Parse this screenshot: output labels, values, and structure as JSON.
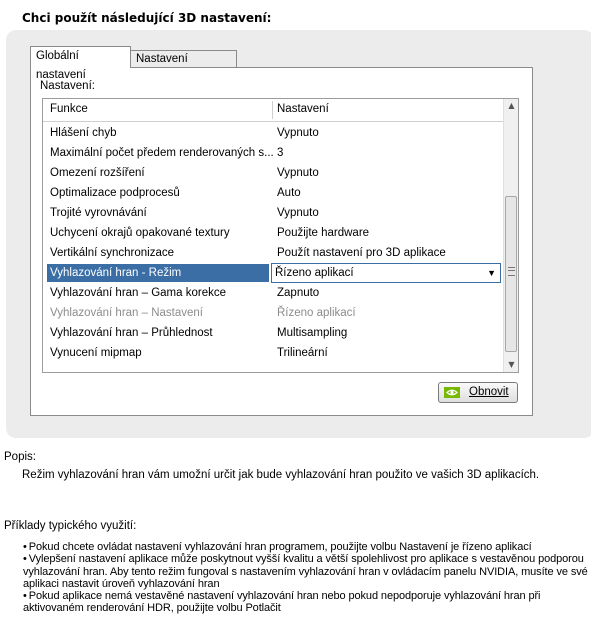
{
  "heading": "Chci použít následující 3D nastavení:",
  "tabs": [
    {
      "label": "Globální nastavení",
      "active": true
    },
    {
      "label": "Nastavení programu",
      "active": false
    }
  ],
  "settings_label": "Nastavení:",
  "columns": {
    "feature": "Funkce",
    "setting": "Nastavení"
  },
  "rows": [
    {
      "feature": "Hlášení chyb",
      "setting": "Vypnuto",
      "state": "normal"
    },
    {
      "feature": "Maximální počet předem renderovaných s...",
      "setting": "3",
      "state": "normal"
    },
    {
      "feature": "Omezení rozšíření",
      "setting": "Vypnuto",
      "state": "normal"
    },
    {
      "feature": "Optimalizace podprocesů",
      "setting": "Auto",
      "state": "normal"
    },
    {
      "feature": "Trojité vyrovnávání",
      "setting": "Vypnuto",
      "state": "normal"
    },
    {
      "feature": "Uchycení okrajů opakované textury",
      "setting": "Použijte hardware",
      "state": "normal"
    },
    {
      "feature": "Vertikální synchronizace",
      "setting": "Použít nastavení pro 3D aplikace",
      "state": "normal"
    },
    {
      "feature": "Vyhlazování hran - Režim",
      "setting": "Řízeno aplikací",
      "state": "selected"
    },
    {
      "feature": "Vyhlazování hran – Gama korekce",
      "setting": "Zapnuto",
      "state": "normal"
    },
    {
      "feature": "Vyhlazování hran – Nastavení",
      "setting": "Řízeno aplikací",
      "state": "disabled"
    },
    {
      "feature": "Vyhlazování hran – Průhlednost",
      "setting": "Multisampling",
      "state": "normal"
    },
    {
      "feature": "Vynucení mipmap",
      "setting": "Trilineární",
      "state": "normal"
    }
  ],
  "restore_button": "Obnovit",
  "description": {
    "title": "Popis:",
    "text": "Režim vyhlazování hran vám umožní určit jak bude vyhlazování hran použito ve vašich 3D aplikacích."
  },
  "examples": {
    "title": "Příklady typického využití:",
    "items": [
      "Pokud chcete ovládat nastavení vyhlazování hran programem, použijte volbu Nastavení je řízeno aplikací",
      "Vylepšení nastavení aplikace může poskytnout vyšší kvalitu a větší spolehlivost pro aplikace s vestavěnou podporou vyhlazování hran. Aby tento režim fungoval s nastavením vyhlazování hran v ovládacím panelu NVIDIA, musíte ve své aplikaci nastavit úroveň vyhlazování hran",
      "Pokud aplikace nemá vestavěné nastavení vyhlazování hran nebo pokud nepodporuje vyhlazování hran při aktivovaném renderování HDR, použijte volbu Potlačit"
    ]
  },
  "colors": {
    "selection": "#3a6ea5",
    "panel_bg": "#ececec",
    "nvidia_green": "#76b900"
  },
  "icons": {
    "restore": "nvidia-logo-icon",
    "dropdown": "chevron-down-icon",
    "scroll_up": "scroll-up-arrow-icon",
    "scroll_down": "scroll-down-arrow-icon"
  }
}
